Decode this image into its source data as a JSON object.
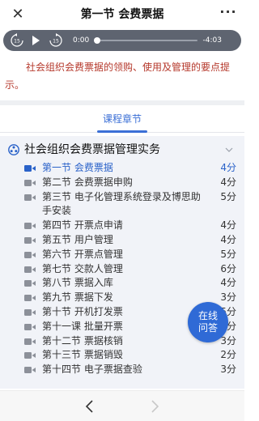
{
  "header": {
    "title": "第一节 会费票据",
    "close_icon": "close-icon",
    "more_icon": "more-icon"
  },
  "player": {
    "current_time": "0:00",
    "remaining_time": "-4:03",
    "rewind_label": "15",
    "forward_label": "15",
    "progress": 0.0
  },
  "description": "社会组织会费票据的领购、使用及管理的要点提示。",
  "tabs": [
    {
      "label": "课程章节",
      "selected": true
    }
  ],
  "chapter": {
    "title": "社会组织会费票据管理实务",
    "lessons": [
      {
        "title": "第一节 会费票据",
        "duration": "4分",
        "active": true
      },
      {
        "title": "第二节 会费票据申购",
        "duration": "4分",
        "active": false
      },
      {
        "title": "第三节 电子化管理系统登录及博思助手安装",
        "duration": "5分",
        "active": false
      },
      {
        "title": "第四节 开票点申请",
        "duration": "4分",
        "active": false
      },
      {
        "title": "第五节 用户管理",
        "duration": "4分",
        "active": false
      },
      {
        "title": "第六节 开票点管理",
        "duration": "5分",
        "active": false
      },
      {
        "title": "第七节 交款人管理",
        "duration": "6分",
        "active": false
      },
      {
        "title": "第八节 票据入库",
        "duration": "4分",
        "active": false
      },
      {
        "title": "第九节 票据下发",
        "duration": "3分",
        "active": false
      },
      {
        "title": "第十节 开机打发票",
        "duration": "5分",
        "active": false
      },
      {
        "title": "第十一课 批量开票",
        "duration": "5分",
        "active": false
      },
      {
        "title": "第十二节 票据核销",
        "duration": "3分",
        "active": false
      },
      {
        "title": "第十三节 票据销毁",
        "duration": "2分",
        "active": false
      },
      {
        "title": "第十四节 电子票据查验",
        "duration": "3分",
        "active": false
      }
    ]
  },
  "floating_button": {
    "label": "在线\n问答"
  },
  "colors": {
    "accent": "#2a62c9",
    "description_text": "#b5382b",
    "player_bg": "#5e6470",
    "chapter_bg": "#f1f3f8"
  }
}
